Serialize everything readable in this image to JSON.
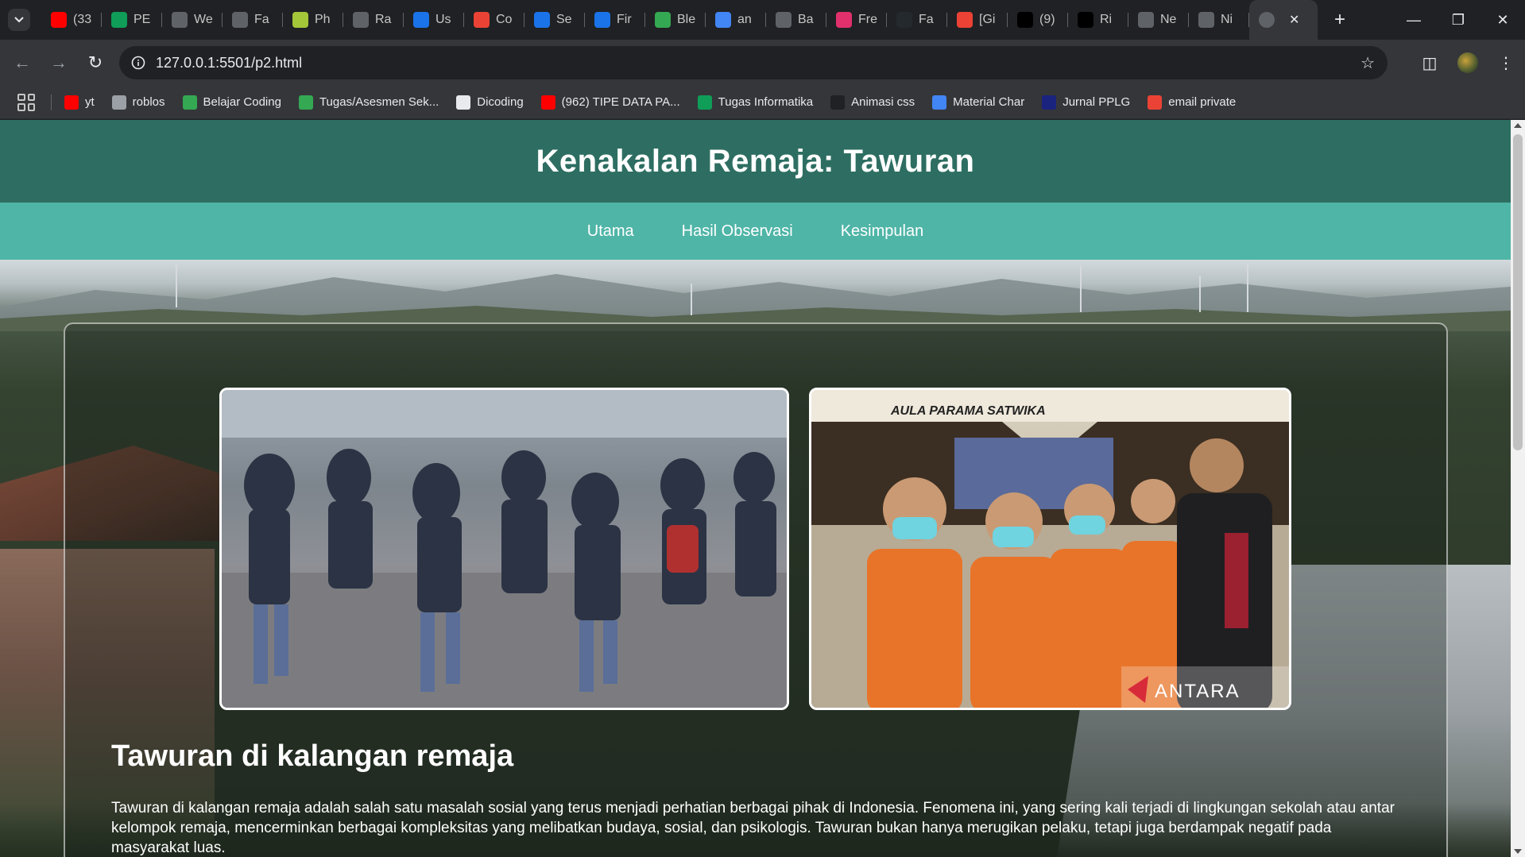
{
  "browser": {
    "tabs": [
      {
        "label": "(33",
        "icon": "youtube-icon",
        "color": "#ff0000"
      },
      {
        "label": "PE",
        "icon": "sheets-icon",
        "color": "#0f9d58"
      },
      {
        "label": "We",
        "icon": "globe-icon",
        "color": "#5f6368"
      },
      {
        "label": "Fa",
        "icon": "globe-icon",
        "color": "#5f6368"
      },
      {
        "label": "Ph",
        "icon": "php-icon",
        "color": "#a4c639"
      },
      {
        "label": "Ra",
        "icon": "person-icon",
        "color": "#5f6368"
      },
      {
        "label": "Us",
        "icon": "flag-icon",
        "color": "#1a73e8"
      },
      {
        "label": "Co",
        "icon": "gmail-icon",
        "color": "#ea4335"
      },
      {
        "label": "Se",
        "icon": "flag-icon",
        "color": "#1a73e8"
      },
      {
        "label": "Fir",
        "icon": "flag-icon",
        "color": "#1a73e8"
      },
      {
        "label": "Ble",
        "icon": "blender-icon",
        "color": "#34a853"
      },
      {
        "label": "an",
        "icon": "google-icon",
        "color": "#4285f4"
      },
      {
        "label": "Ba",
        "icon": "globe-icon",
        "color": "#5f6368"
      },
      {
        "label": "Fre",
        "icon": "instagram-icon",
        "color": "#e1306c"
      },
      {
        "label": "Fa",
        "icon": "github-icon",
        "color": "#24292e"
      },
      {
        "label": "[Gi",
        "icon": "gmail-icon",
        "color": "#ea4335"
      },
      {
        "label": "(9)",
        "icon": "x-icon",
        "color": "#000000"
      },
      {
        "label": "Ri",
        "icon": "game-icon",
        "color": "#000000"
      },
      {
        "label": "Ne",
        "icon": "chrome-icon",
        "color": "#5f6368"
      },
      {
        "label": "Ni",
        "icon": "globe-icon",
        "color": "#5f6368"
      }
    ],
    "active_tab": {
      "icon": "globe-icon"
    },
    "url": "127.0.0.1:5501/p2.html",
    "bookmarks": [
      {
        "label": "yt",
        "icon": "youtube-icon",
        "color": "#ff0000"
      },
      {
        "label": "roblos",
        "icon": "roblox-icon",
        "color": "#9aa0a6"
      },
      {
        "label": "Belajar Coding",
        "icon": "w-icon",
        "color": "#34a853"
      },
      {
        "label": "Tugas/Asesmen Sek...",
        "icon": "classroom-icon",
        "color": "#34a853"
      },
      {
        "label": "Dicoding",
        "icon": "dicoding-icon",
        "color": "#e8eaed"
      },
      {
        "label": "(962) TIPE DATA PA...",
        "icon": "youtube-icon",
        "color": "#ff0000"
      },
      {
        "label": "Tugas Informatika",
        "icon": "sheets-icon",
        "color": "#0f9d58"
      },
      {
        "label": "Animasi css",
        "icon": "a-icon",
        "color": "#202124"
      },
      {
        "label": "Material Char",
        "icon": "circle-icon",
        "color": "#4285f4"
      },
      {
        "label": "Jurnal PPLG",
        "icon": "square-icon",
        "color": "#1a237e"
      },
      {
        "label": "email private",
        "icon": "gmail-icon",
        "color": "#ea4335"
      }
    ]
  },
  "page": {
    "title": "Kenakalan Remaja: Tawuran",
    "nav": [
      "Utama",
      "Hasil Observasi",
      "Kesimpulan"
    ],
    "photo_2_watermark": "ANTARA",
    "photo_2_sign": "AULA PARAMA SATWIKA",
    "section_title": "Tawuran di kalangan remaja",
    "paragraph": "Tawuran di kalangan remaja adalah salah satu masalah sosial yang terus menjadi perhatian berbagai pihak di Indonesia. Fenomena ini, yang sering kali terjadi di lingkungan sekolah atau antar kelompok remaja, mencerminkan berbagai kompleksitas yang melibatkan budaya, sosial, dan psikologis. Tawuran bukan hanya merugikan pelaku, tetapi juga berdampak negatif pada masyarakat luas."
  },
  "colors": {
    "header": "#2e6e62",
    "nav": "#4fb5a7"
  }
}
